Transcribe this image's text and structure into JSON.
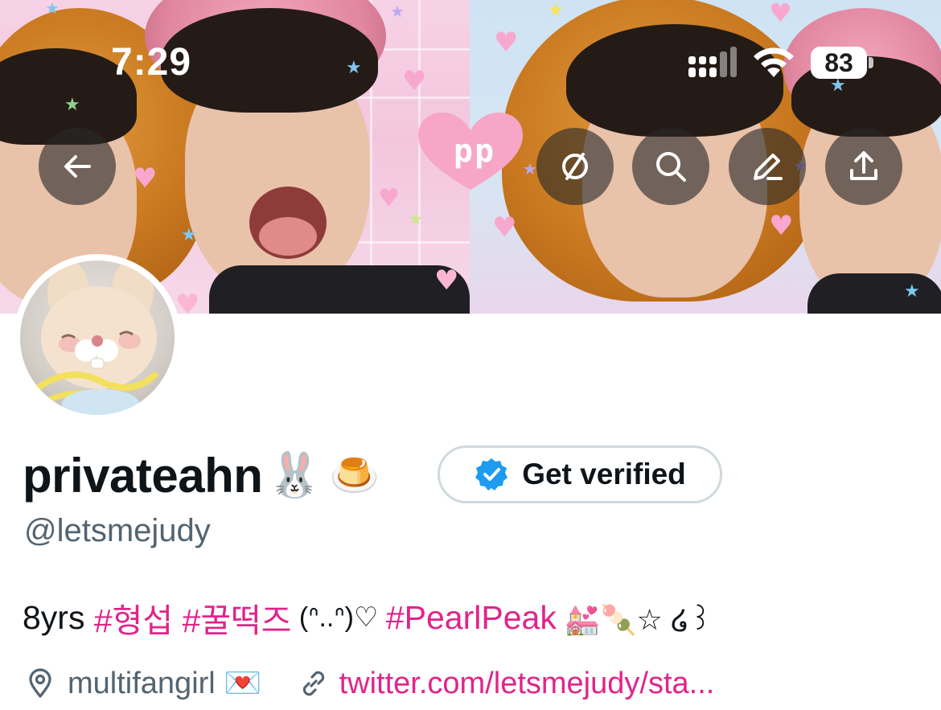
{
  "status_bar": {
    "time": "7:29",
    "battery_level": "83",
    "signal_icon": "cellular-signal-icon",
    "wifi_icon": "wifi-icon"
  },
  "banner": {
    "logo_text": "pp",
    "buttons": [
      {
        "name": "back-button",
        "icon": "arrow-left-icon"
      },
      {
        "name": "sync-button",
        "icon": "circle-slash-icon"
      },
      {
        "name": "search-button",
        "icon": "search-icon"
      },
      {
        "name": "edit-button",
        "icon": "pencil-icon"
      },
      {
        "name": "share-button",
        "icon": "share-upload-icon"
      }
    ]
  },
  "profile": {
    "display_name": "privateahn",
    "name_emojis": [
      "🐰",
      "🍮"
    ],
    "verify_label": "Get verified",
    "handle": "@letsmejudy",
    "bio": {
      "prefix": "8yrs ",
      "tag1": "#형섭",
      "tag2": "#꿀떡즈",
      "kaomoji": " (ᐢ..ᐢ)♡ ",
      "tag3": "#PearlPeak",
      "suffix": " 💒🍡☆ ໒꒱"
    },
    "location": "multifangirl 💌",
    "website": "twitter.com/letsmejudy/sta..."
  },
  "colors": {
    "accent_pink": "#e0248a",
    "text_primary": "#0f1419",
    "text_secondary": "#536471",
    "verified_blue": "#1d9bf0",
    "button_border": "#cfd9de"
  }
}
